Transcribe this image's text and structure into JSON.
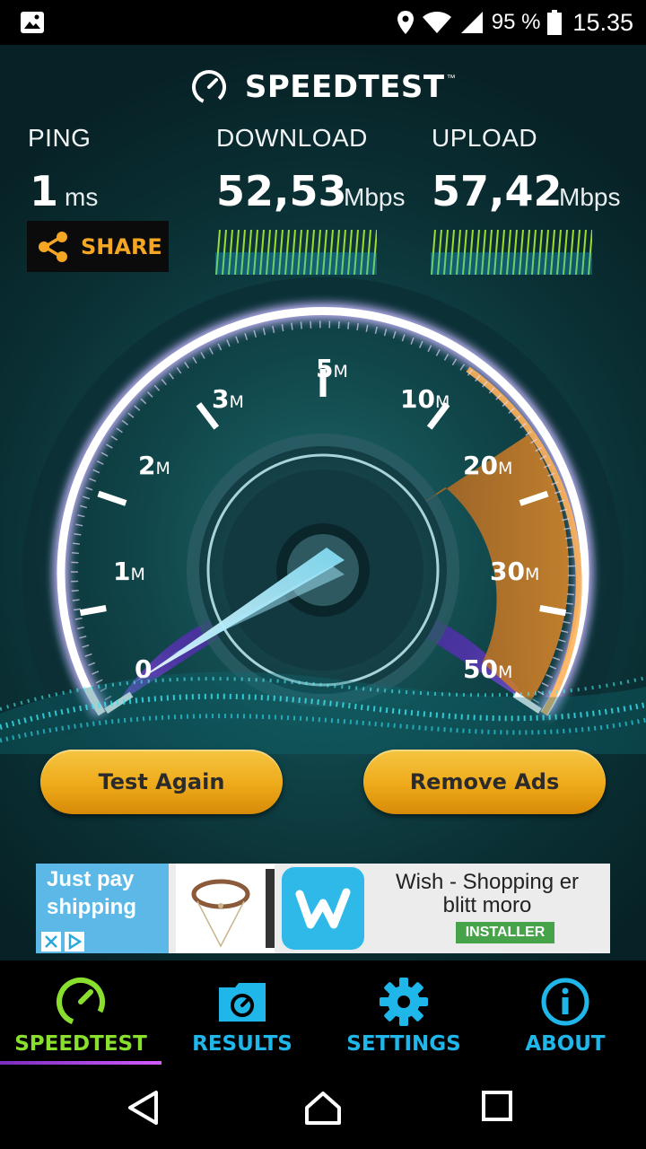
{
  "status_bar": {
    "battery": "95 %",
    "time": "15.35",
    "icons": [
      "gallery-icon",
      "location-icon",
      "wifi-icon",
      "signal-icon",
      "battery-icon"
    ]
  },
  "brand": {
    "title": "SPEEDTEST",
    "tm": "™"
  },
  "metrics": {
    "ping": {
      "label": "PING",
      "value": "1",
      "unit": "ms"
    },
    "download": {
      "label": "DOWNLOAD",
      "value": "52,53",
      "unit": "Mbps"
    },
    "upload": {
      "label": "UPLOAD",
      "value": "57,42",
      "unit": "Mbps"
    }
  },
  "share": {
    "label": "SHARE"
  },
  "gauge": {
    "ticks": [
      {
        "num": "0",
        "suffix": ""
      },
      {
        "num": "1",
        "suffix": "M"
      },
      {
        "num": "2",
        "suffix": "M"
      },
      {
        "num": "3",
        "suffix": "M"
      },
      {
        "num": "5",
        "suffix": "M"
      },
      {
        "num": "10",
        "suffix": "M"
      },
      {
        "num": "20",
        "suffix": "M"
      },
      {
        "num": "30",
        "suffix": "M"
      },
      {
        "num": "50",
        "suffix": "M"
      }
    ]
  },
  "buttons": {
    "test_again": "Test Again",
    "remove_ads": "Remove Ads"
  },
  "ad": {
    "tagline_1": "Just pay",
    "tagline_2": "shipping",
    "title_1": "Wish - Shopping er",
    "title_2": "blitt moro",
    "install": "INSTALLER"
  },
  "tabs": [
    {
      "label": "SPEEDTEST",
      "icon": "speedometer-icon",
      "active": true
    },
    {
      "label": "RESULTS",
      "icon": "results-folder-icon",
      "active": false
    },
    {
      "label": "SETTINGS",
      "icon": "gear-icon",
      "active": false
    },
    {
      "label": "ABOUT",
      "icon": "info-icon",
      "active": false
    }
  ],
  "colors": {
    "accent_orange": "#f5a623",
    "tab_blue": "#1fb6ea",
    "tab_active_green": "#8adf2e",
    "gauge_violet": "#5b3fa0",
    "button_gold": "#eeaa1a"
  }
}
